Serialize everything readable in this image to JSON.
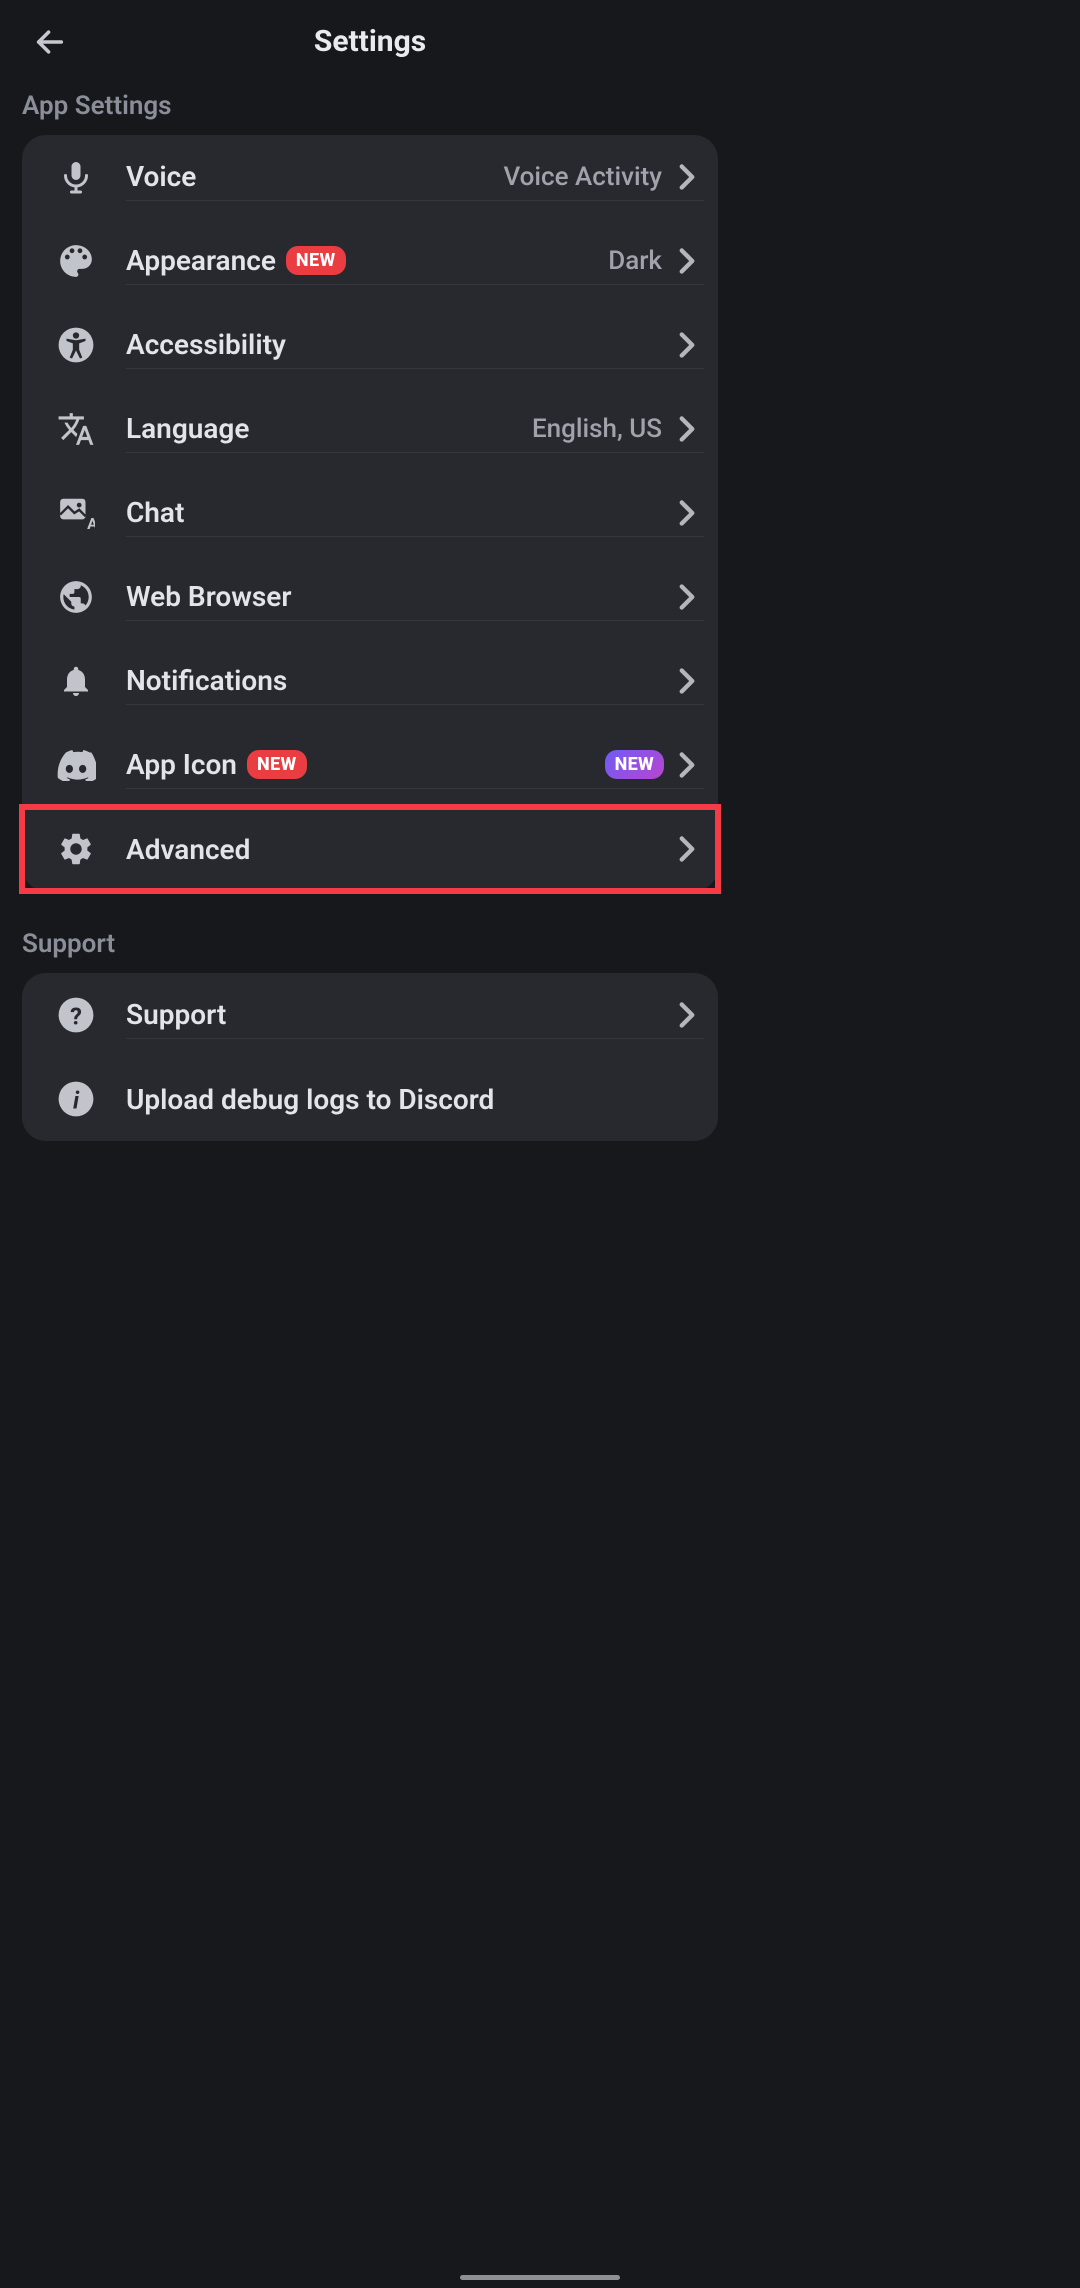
{
  "header": {
    "title": "Settings"
  },
  "sections": {
    "appSettings": {
      "title": "App Settings",
      "items": [
        {
          "label": "Voice",
          "value": "Voice Activity"
        },
        {
          "label": "Appearance",
          "value": "Dark",
          "badge_red": "NEW"
        },
        {
          "label": "Accessibility",
          "value": ""
        },
        {
          "label": "Language",
          "value": "English, US"
        },
        {
          "label": "Chat",
          "value": ""
        },
        {
          "label": "Web Browser",
          "value": ""
        },
        {
          "label": "Notifications",
          "value": ""
        },
        {
          "label": "App Icon",
          "value": "",
          "badge_red": "NEW",
          "badge_purple": "NEW"
        },
        {
          "label": "Advanced",
          "value": "",
          "highlighted": true
        }
      ]
    },
    "support": {
      "title": "Support",
      "items": [
        {
          "label": "Support",
          "value": ""
        },
        {
          "label": "Upload debug logs to Discord",
          "value": ""
        }
      ]
    }
  }
}
